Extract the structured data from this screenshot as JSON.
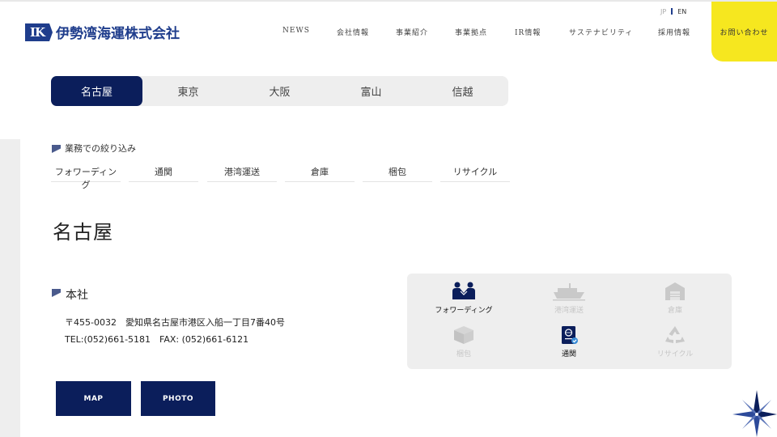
{
  "header": {
    "logo_mark": "IK",
    "logo_text": "伊勢湾海運株式会社",
    "nav": [
      "NEWS",
      "会社情報",
      "事業紹介",
      "事業拠点",
      "IR情報",
      "サステナビリティ",
      "採用情報"
    ],
    "lang": {
      "jp": "JP",
      "en": "EN"
    },
    "contact": "お問い合わせ"
  },
  "regions": {
    "tabs": [
      "名古屋",
      "東京",
      "大阪",
      "富山",
      "信越"
    ],
    "active": "名古屋"
  },
  "filter": {
    "label": "業務での絞り込み",
    "chips": [
      "フォワーディング",
      "通関",
      "港湾運送",
      "倉庫",
      "梱包",
      "リサイクル"
    ]
  },
  "city": "名古屋",
  "office": {
    "title": "本社",
    "address": "〒455-0032　愛知県名古屋市港区入船一丁目7番40号",
    "phone": "TEL:(052)661-5181　FAX: (052)661-6121",
    "map_label": "MAP",
    "photo_label": "PHOTO"
  },
  "services": [
    {
      "label": "フォワーディング",
      "icon": "handshake-icon",
      "active": true
    },
    {
      "label": "港湾運送",
      "icon": "ship-icon",
      "active": false
    },
    {
      "label": "倉庫",
      "icon": "warehouse-icon",
      "active": false
    },
    {
      "label": "梱包",
      "icon": "box-icon",
      "active": false
    },
    {
      "label": "通関",
      "icon": "passport-icon",
      "active": true
    },
    {
      "label": "リサイクル",
      "icon": "recycle-icon",
      "active": false
    }
  ],
  "colors": {
    "navy": "#0b1e5b",
    "brand": "#1f3d8c",
    "accent": "#f6e71f",
    "panel": "#eeeeee"
  }
}
